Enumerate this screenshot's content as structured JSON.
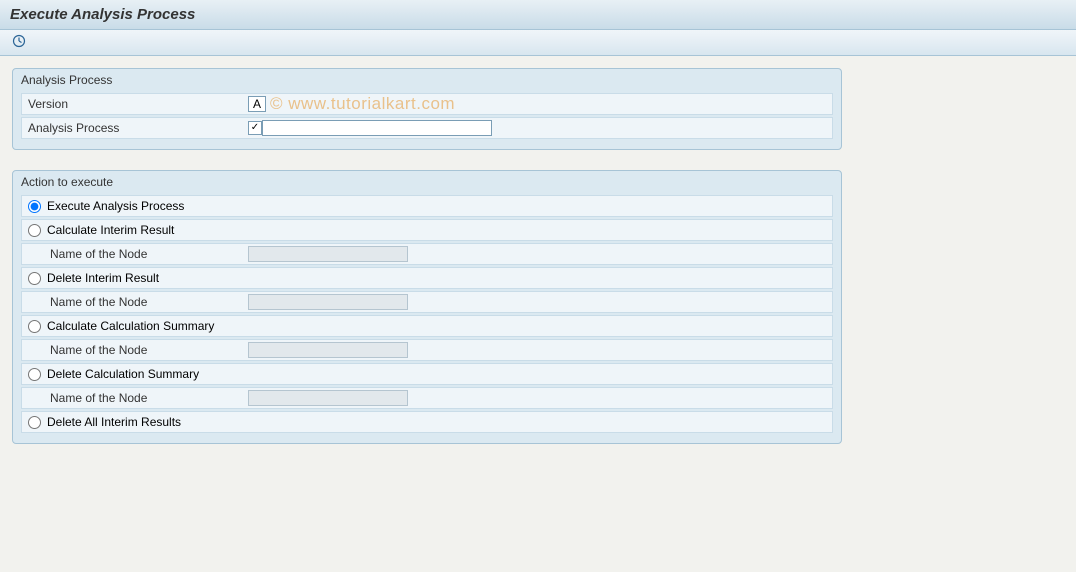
{
  "title": "Execute Analysis Process",
  "watermark": "© www.tutorialkart.com",
  "toolbar": {
    "execute_icon": "clock-execute-icon"
  },
  "group1": {
    "title": "Analysis Process",
    "version_label": "Version",
    "version_value": "A",
    "analysis_process_label": "Analysis Process",
    "analysis_process_value": ""
  },
  "group2": {
    "title": "Action to execute",
    "options": [
      {
        "label": "Execute Analysis Process",
        "selected": true,
        "has_sub": false
      },
      {
        "label": "Calculate Interim Result",
        "selected": false,
        "has_sub": true,
        "sub_label": "Name of the Node",
        "sub_value": ""
      },
      {
        "label": "Delete Interim Result",
        "selected": false,
        "has_sub": true,
        "sub_label": "Name of the Node",
        "sub_value": ""
      },
      {
        "label": "Calculate Calculation Summary",
        "selected": false,
        "has_sub": true,
        "sub_label": "Name of the Node",
        "sub_value": ""
      },
      {
        "label": "Delete Calculation Summary",
        "selected": false,
        "has_sub": true,
        "sub_label": "Name of the Node",
        "sub_value": ""
      },
      {
        "label": "Delete All Interim Results",
        "selected": false,
        "has_sub": false
      }
    ]
  }
}
